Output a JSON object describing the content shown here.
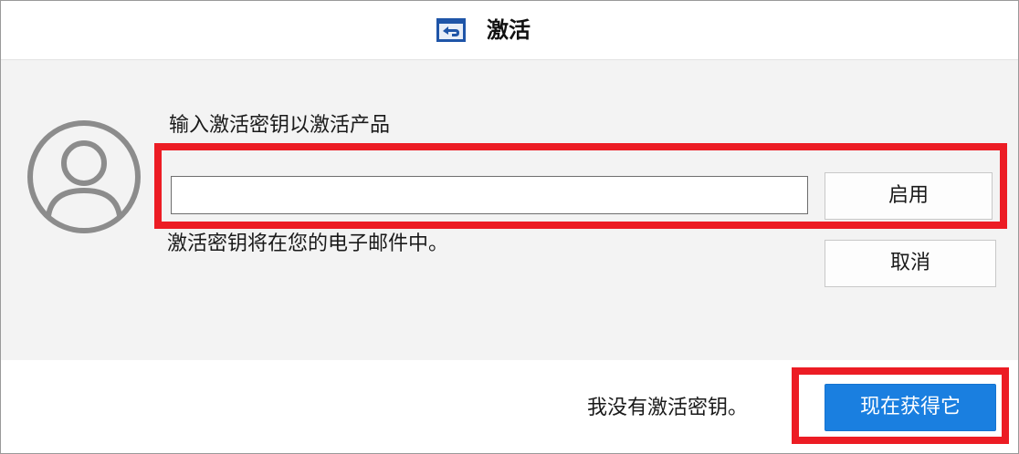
{
  "window": {
    "title": "激活"
  },
  "main": {
    "prompt": "输入激活密钥以激活产品",
    "key_input": {
      "value": "",
      "placeholder": ""
    },
    "hint": "激活密钥将在您的电子邮件中。"
  },
  "buttons": {
    "enable": "启用",
    "cancel": "取消",
    "buy": "现在获得它"
  },
  "footer": {
    "no_key_text": "我没有激活密钥。"
  },
  "colors": {
    "primary_button": "#1a7fe0",
    "highlight": "#ec1c24",
    "title_icon": "#1f55a8"
  },
  "icons": {
    "title": "back-folder-icon",
    "avatar": "user-avatar-icon"
  }
}
